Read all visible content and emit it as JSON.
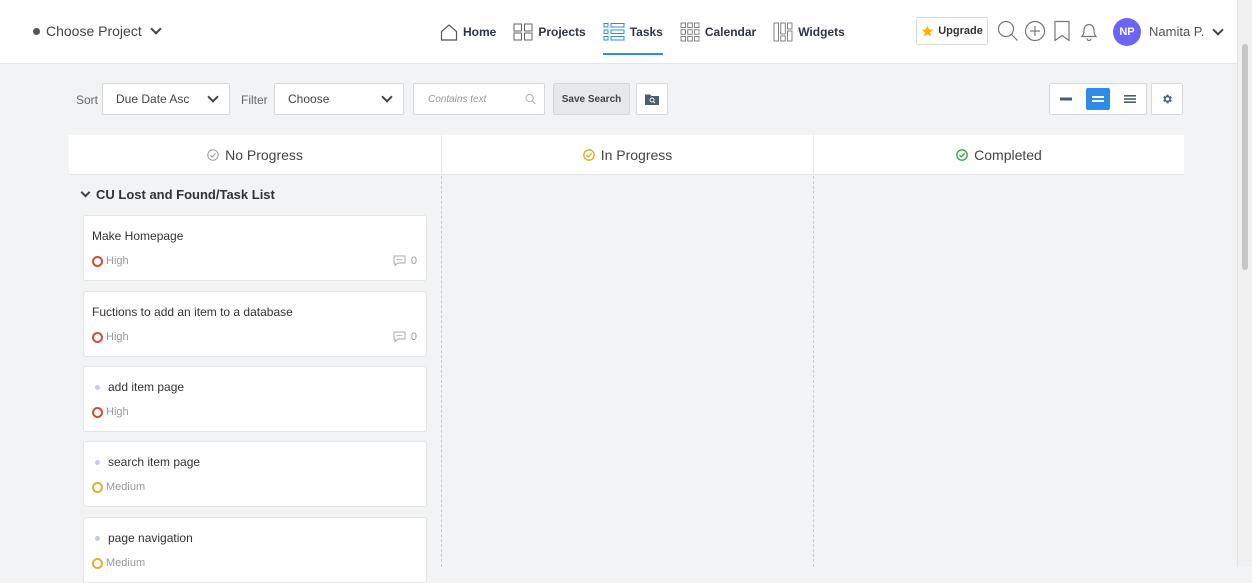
{
  "header": {
    "project_selector": "Choose Project",
    "nav": [
      {
        "label": "Home",
        "icon": "home-icon"
      },
      {
        "label": "Projects",
        "icon": "projects-grid-icon"
      },
      {
        "label": "Tasks",
        "icon": "tasks-list-icon",
        "active": true
      },
      {
        "label": "Calendar",
        "icon": "calendar-icon"
      },
      {
        "label": "Widgets",
        "icon": "widgets-icon"
      }
    ],
    "upgrade_label": "Upgrade",
    "avatar_initials": "NP",
    "user_name": "Namita P.",
    "accent_color": "#2d8ce8",
    "avatar_color": "#6e63f7"
  },
  "toolbar": {
    "sort_label": "Sort",
    "sort_value": "Due Date Asc",
    "filter_label": "Filter",
    "filter_value": "Choose",
    "search_placeholder": "Contains text",
    "save_search_label": "Save Search"
  },
  "columns": [
    {
      "title": "No Progress",
      "status_color": "#999999"
    },
    {
      "title": "In Progress",
      "status_color": "#e0a818"
    },
    {
      "title": "Completed",
      "status_color": "#2aa348"
    }
  ],
  "group": {
    "title": "CU Lost and Found/Task List"
  },
  "tasks": [
    {
      "title": "Make Homepage",
      "priority": "High",
      "comments": "0",
      "priority_color": "#d9483b"
    },
    {
      "title": "Fuctions to add an item to a database",
      "priority": "High",
      "comments": "0",
      "priority_color": "#d9483b"
    },
    {
      "title": "add item page",
      "priority": "High",
      "priority_color": "#d9483b"
    },
    {
      "title": "search item page",
      "priority": "Medium",
      "priority_color": "#e0b02a"
    },
    {
      "title": "page navigation",
      "priority": "Medium",
      "priority_color": "#e0b02a"
    }
  ]
}
